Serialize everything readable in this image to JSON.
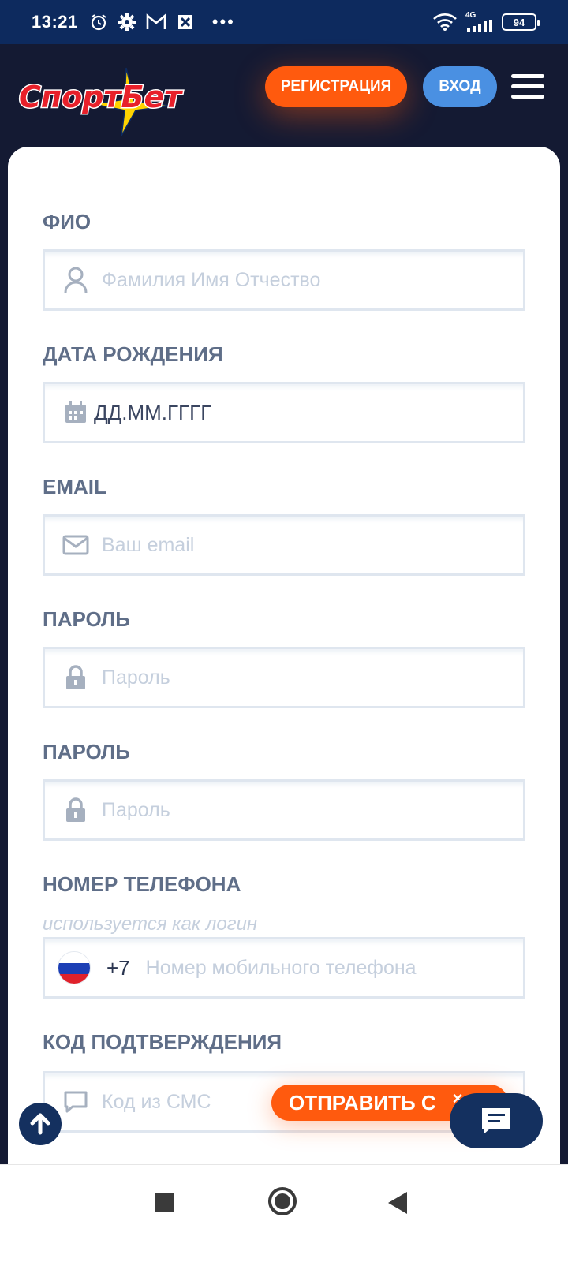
{
  "status_bar": {
    "time": "13:21",
    "network": "4G",
    "battery": "94"
  },
  "header": {
    "logo_text": "СпортБет",
    "register_label": "РЕГИСТРАЦИЯ",
    "login_label": "ВХОД"
  },
  "form": {
    "fio": {
      "label": "ФИО",
      "placeholder": "Фамилия Имя Отчество",
      "icon": "user-icon"
    },
    "birth": {
      "label": "ДАТА РОЖДЕНИЯ",
      "value": "ДД.ММ.ГГГГ",
      "icon": "calendar-icon"
    },
    "email": {
      "label": "EMAIL",
      "placeholder": "Ваш email",
      "icon": "envelope-icon"
    },
    "password": {
      "label": "ПАРОЛЬ",
      "placeholder": "Пароль",
      "icon": "lock-icon"
    },
    "password_repeat": {
      "label": "ПАРОЛЬ",
      "placeholder": "Пароль",
      "icon": "lock-icon"
    },
    "phone": {
      "label": "НОМЕР ТЕЛЕФОНА",
      "hint": "используется как логин",
      "prefix": "+7",
      "placeholder": "Номер мобильного телефона",
      "icon": "russia-flag-icon"
    },
    "code": {
      "label": "КОД ПОДТВЕРЖДЕНИЯ",
      "placeholder": "Код из СМС",
      "icon": "chat-bubble-icon"
    }
  },
  "floating": {
    "send_label": "ОТПРАВИТЬ С",
    "close_label": "×"
  },
  "colors": {
    "accent_orange": "#ff5a0e",
    "accent_blue": "#4a90e2",
    "header_bg": "#141a33",
    "status_bg": "#0d2a5e",
    "label_gray": "#5f6e88",
    "placeholder_gray": "#c5cfdd"
  }
}
